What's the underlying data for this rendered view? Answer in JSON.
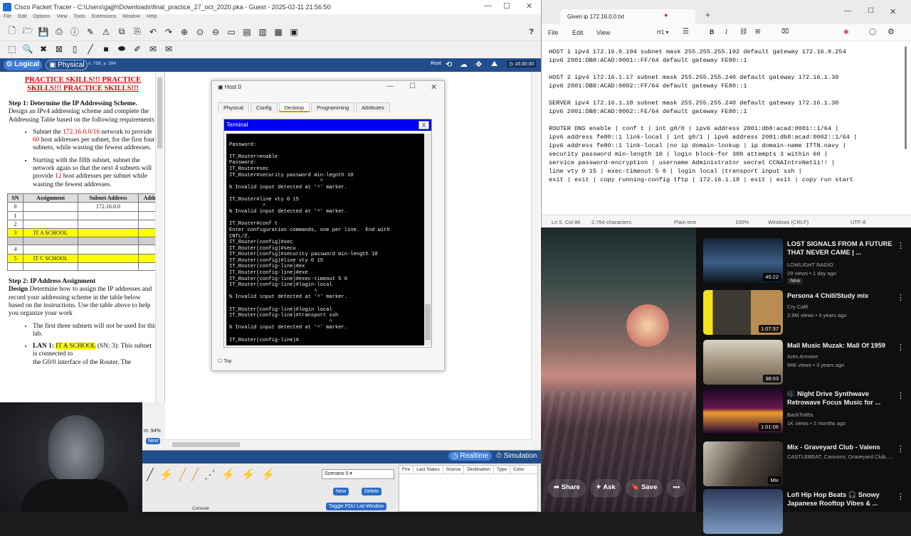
{
  "pt": {
    "title": "Cisco Packet Tracer - C:\\Users\\gajjh\\Downloads\\final_practice_27_oct_2020.pka - Guest - 2025-02-11 21:56:50",
    "menu": [
      "File",
      "Edit",
      "Options",
      "View",
      "Tools",
      "Extensions",
      "Window",
      "Help"
    ],
    "tab_logical": "Logical",
    "tab_physical": "Physical",
    "coords": "x: 758, y: 284",
    "root_label": "Root",
    "clock": "16:30:00",
    "doc": {
      "heading": "PRACTICE SKILLS!!! PRACTICE SKILLS!!! PRACTICE SKILLS!!!",
      "step1_title": "Step 1: Determine the IP Addressing Scheme.",
      "step1_text": "Design an IPv4 addressing scheme and complete the Addressing Table based on the following requirements",
      "bullet1_a": "Subnet the ",
      "bullet1_net": "172.16.0.0/16",
      "bullet1_b": " network to provide ",
      "bullet1_n": "60",
      "bullet1_c": " host addresses per subnet, for the first four subnets, while wasting the fewest addresses.",
      "bullet2_a": "Starting with the fifth subnet, subnet the network again so that the next 4 subnets will provide ",
      "bullet2_n": "12",
      "bullet2_b": " host addresses per subnet while wasting the fewest addresses.",
      "table_headers": [
        "SN",
        "Assignment",
        "Subnet Address",
        "Addr"
      ],
      "table_rows": [
        [
          "0",
          "",
          "172.16.0.0",
          ""
        ],
        [
          "1",
          "",
          "",
          ""
        ],
        [
          "2",
          "",
          "",
          ""
        ],
        [
          "3",
          "IT A SCHOOL",
          "",
          ""
        ],
        [
          "",
          "",
          "",
          ""
        ],
        [
          "4",
          "",
          "",
          ""
        ],
        [
          "5",
          "IT C SCHOOL",
          "",
          ""
        ],
        [
          "",
          "",
          "",
          ""
        ]
      ],
      "step2_title": "Step 2: IP Address Assignment",
      "step2_lead": "Design",
      "step2_text": " Determine how to assign the IP addresses and record your addressing scheme in the table below based on the instructions. Use the table above to help you organize your work",
      "bullet3": "The first three subnets will not be used for this lab.",
      "bullet4_a": "LAN 1: ",
      "bullet4_hl": "IT A SCHOOL",
      "bullet4_b": " (SN: 3): This subnet is connected to",
      "bullet4_c": "the G0/0 interface of the Router. The"
    },
    "zoom": "m: 94%",
    "next_label": "Next",
    "realtime_label": "Realtime",
    "simulation_label": "Simulation",
    "scenario_label": "Scenario 0",
    "new_label": "New",
    "delete_label": "Delete",
    "toggle_pdu_label": "Toggle PDU List Window",
    "pdu_columns": [
      "Fire",
      "Last Status",
      "Source",
      "Destination",
      "Type",
      "Color"
    ],
    "console_label": "Console"
  },
  "host": {
    "title": "Host 0",
    "tabs": [
      "Physical",
      "Config",
      "Desktop",
      "Programming",
      "Attributes"
    ],
    "terminal_title": "Terminal",
    "terminal_close": "X",
    "top_label": "Top",
    "terminal_text": "\nPassword:\n\nIT_Router>enable\nPassword:\nIT_Router#sec\nIT_Router#security password min-legnth 10\n                              ^\n% Invalid input detected at '^' marker.\n\nIT_Router#line vty 0 15\n           ^\n% Invalid input detected at '^' marker.\n\nIT_Router#conf t\nEnter configuration commands, one per line.  End with\nCNTL/Z.\nIT_Router(config)#sec\nIT_Router(config)#secu\nIT_Router(config)#security password min-length 10\nIT_Router(config)#line vty 0 15\nIT_Router(config-line)#ex\nIT_Router(config-line)#exe\nIT_Router(config-line)#exec-timeout 5 0\nIT_Router(config-line)#login-local\n                            ^\n% Invalid input detected at '^' marker.\n\nIT_Router(config-line)#login local\nIT_Router(config-line)#transport ssh\n                                 ^\n% Invalid input detected at '^' marker.\n\nIT_Router(config-line)#"
  },
  "notepad": {
    "tab_title": "Given ip 172.16.0.0.txt",
    "menu": [
      "File",
      "Edit",
      "View"
    ],
    "heading_label": "H1",
    "content": "HOST 1 ipv4 172.16.0.194 subnet mask 255.255.255.192 default gateway 172.16.0.254\nipv6 2001:DB8:ACAD:0001::FF/64 default gateway FE80::1\n\nHOST 2 ipv4 172.16.1.17 subnet mask 255.255.255.240 default gateway 172.16.1.30\nipv6 2001:DB8:ACAD:0002::FF/64 default gateway FE80::1\n\nSERVER ipv4 172.16.1.18 subnet mask 255.255.255.240 default gateway 172.16.1.30\nipv6 2001:DB8:ACAD:0002::FE/64 default gateway FE80::1\n\nROUTER DNS enable | conf t | int g0/0 | ipv6 address 2001:db8:acad:0001::1/64 |\nipv6 address fe80::1 link-local | int g0/1 | ipv6 address 2001:db8:acad:0002::1/64 |\nipv6 address fe80::1 link-local |no ip domain-lookup | ip domain-name ITTN.navy |\nsecurity password min-length 10 | login block-for 300 attempts 3 within 60 |\nservice password-encryption | username Administrator secret CCNAIntroNet11!! |\nline vty 0 15 | exec-timeout 5 0 | login local |transport input ssh |\nexit | exit | copy running-config tftp | 172.16.1.18 | exit | exit | copy run start",
    "status_pos": "Ln 5, Col 86",
    "status_chars": "2,764 characters",
    "status_format": "Plain text",
    "status_zoom": "100%",
    "status_eol": "Windows (CRLF)",
    "status_enc": "UTF-8"
  },
  "youtube": {
    "actions": {
      "share": "Share",
      "ask": "Ask",
      "save": "Save"
    },
    "videos": [
      {
        "title": "LOST SIGNALS FROM A FUTURE THAT NEVER CAME | ...",
        "channel": "LOWLIGHT RADIO",
        "meta": "29 views • 1 day ago",
        "badge": "New",
        "duration": "45:22"
      },
      {
        "title": "Persona 4 Chill/Study mix",
        "channel": "Cry Café",
        "meta": "2.8M views • 4 years ago",
        "badge": "",
        "duration": "1:07:37"
      },
      {
        "title": "Mall Music Muzak: Mall Of 1959",
        "channel": "Ares Armoire",
        "meta": "94K views • 3 years ago",
        "badge": "",
        "duration": "38:03"
      },
      {
        "title": "🎼 Night Drive Synthwave Retrowave Focus Music for ...",
        "channel": "BackTo80s",
        "meta": "1K views • 2 months ago",
        "badge": "",
        "duration": "1:01:06"
      },
      {
        "title": "Mix - Graveyard Club - Valens",
        "channel": "CASTLEBEAT, Cannons, Graveyard Club, ...",
        "meta": "",
        "badge": "",
        "duration": "Mix"
      },
      {
        "title": "Lofi Hip Hop Beats 🎧 Snowy Japanese Rooftop Vibes & ...",
        "channel": "",
        "meta": "",
        "badge": "",
        "duration": ""
      }
    ]
  }
}
